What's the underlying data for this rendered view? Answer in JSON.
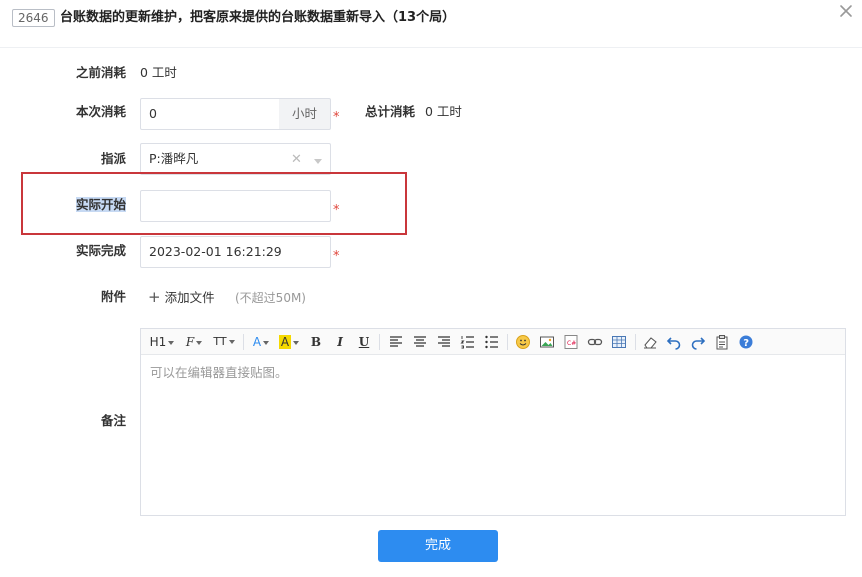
{
  "header": {
    "task_id": "2646",
    "title": "台账数据的更新维护，把客原来提供的台账数据重新导入（13个局）"
  },
  "colors": {
    "accent": "#2d8cf0",
    "required": "#e0453b",
    "highlight_border": "#c9363b",
    "selected_text_bg": "#c6d9f3"
  },
  "form": {
    "prev_cost": {
      "label": "之前消耗",
      "value": "0 工时"
    },
    "this_cost": {
      "label": "本次消耗",
      "value": "0",
      "unit": "小时"
    },
    "total_cost": {
      "label": "总计消耗",
      "value": "0 工时"
    },
    "assignee": {
      "label": "指派",
      "value": "P:潘晔凡"
    },
    "actual_start": {
      "label": "实际开始",
      "value": ""
    },
    "actual_finish": {
      "label": "实际完成",
      "value": "2023-02-01 16:21:29"
    },
    "attachment": {
      "label": "附件",
      "add_label": "添加文件",
      "hint": "(不超过50M)"
    },
    "remark": {
      "label": "备注",
      "placeholder": "可以在编辑器直接贴图。"
    },
    "required_mark": "*"
  },
  "toolbar": {
    "heading": "H1",
    "font_family": "F",
    "font_size": "TT",
    "font_color": "A",
    "bg_color": "A",
    "bold": "B",
    "italic": "I",
    "underline": "U"
  },
  "submit_label": "完成"
}
